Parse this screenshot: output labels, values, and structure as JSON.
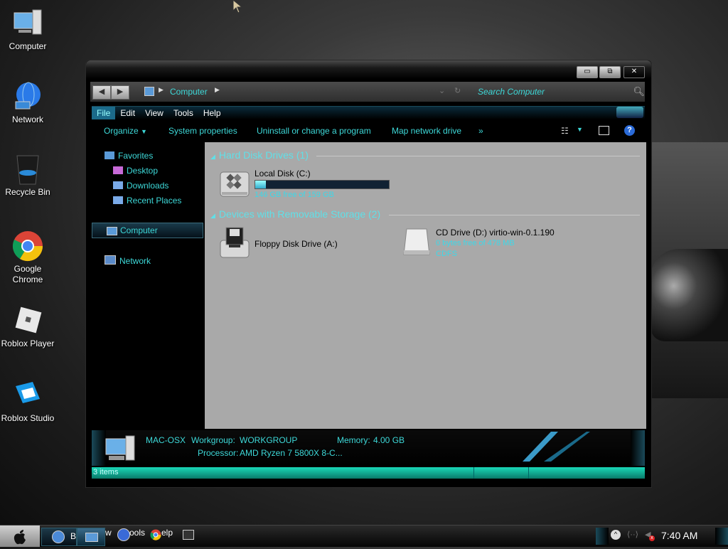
{
  "desktop": {
    "icons": [
      {
        "label": "Computer",
        "icon": "computer-icon"
      },
      {
        "label": "Network",
        "icon": "network-globe-icon"
      },
      {
        "label": "Recycle Bin",
        "icon": "recycle-bin-icon"
      },
      {
        "label": "Google Chrome",
        "icon": "chrome-icon"
      },
      {
        "label": "Roblox Player",
        "icon": "roblox-player-icon"
      },
      {
        "label": "Roblox Studio",
        "icon": "roblox-studio-icon"
      }
    ]
  },
  "window": {
    "title_buttons": {
      "minimize": "▭",
      "maximize": "⧉",
      "close": "✕"
    },
    "address": {
      "crumbs": [
        "Computer"
      ],
      "search_placeholder": "Search Computer"
    },
    "menu": [
      "File",
      "Edit",
      "View",
      "Tools",
      "Help"
    ],
    "commands": [
      "Organize",
      "System properties",
      "Uninstall or change a program",
      "Map network drive",
      "»"
    ],
    "nav": {
      "favorites": "Favorites",
      "favorites_items": [
        "Desktop",
        "Downloads",
        "Recent Places"
      ],
      "computer": "Computer",
      "network": "Network"
    },
    "groups": {
      "hdd": "Hard Disk Drives (1)",
      "removable": "Devices with Removable Storage (2)"
    },
    "drives": {
      "local": {
        "name": "Local Disk (C:)",
        "free": "146 GB free of 159 GB",
        "used_fraction": 0.08
      },
      "floppy": {
        "name": "Floppy Disk Drive (A:)"
      },
      "cd": {
        "name": "CD Drive (D:) virtio-win-0.1.190",
        "free": "0 bytes free of 478 MB",
        "fs": "CDFS"
      }
    },
    "details": {
      "computer_name": "MAC-OSX",
      "workgroup_label": "Workgroup:",
      "workgroup": "WORKGROUP",
      "memory_label": "Memory:",
      "memory": "4.00 GB",
      "processor_label": "Processor:",
      "processor": "AMD Ryzen 7 5800X 8-C..."
    },
    "status": "3 items"
  },
  "taskbar": {
    "items_text": [
      "B",
      "w",
      "ools",
      "elp"
    ],
    "clock": "7:40 AM"
  },
  "colors": {
    "accent": "#3dd8d8",
    "content_bg": "#a9a9a9"
  }
}
